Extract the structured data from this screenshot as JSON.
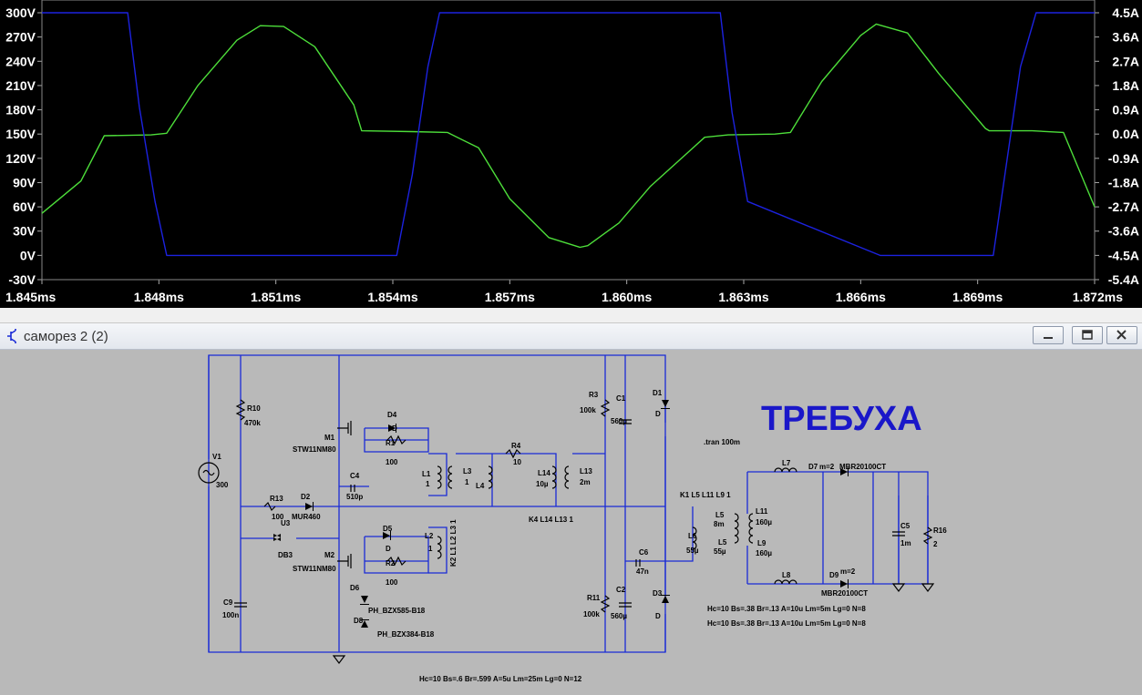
{
  "colors": {
    "plot_background": "#000000",
    "axis_text": "#ffffff",
    "trace_voltage": "#4dde3a",
    "trace_current": "#1c22e0",
    "schematic_background": "#b9b9b9",
    "wire": "#1a2bd6",
    "title_text": "#1a17c9"
  },
  "chart_data": {
    "type": "line",
    "xlabel": "",
    "x_ticks": [
      "1.845ms",
      "1.848ms",
      "1.851ms",
      "1.854ms",
      "1.857ms",
      "1.860ms",
      "1.863ms",
      "1.866ms",
      "1.869ms",
      "1.872ms"
    ],
    "xlim": [
      1.845,
      1.872
    ],
    "left_ticks": [
      "300V",
      "270V",
      "240V",
      "210V",
      "180V",
      "150V",
      "120V",
      "90V",
      "60V",
      "30V",
      "0V",
      "-30V"
    ],
    "ylim_left": [
      -30,
      300
    ],
    "right_ticks": [
      "4.5A",
      "3.6A",
      "2.7A",
      "1.8A",
      "0.9A",
      "0.0A",
      "-0.9A",
      "-1.8A",
      "-2.7A",
      "-3.6A",
      "-4.5A",
      "-5.4A"
    ],
    "ylim_right": [
      -5.4,
      4.5
    ],
    "grid": false,
    "series": [
      {
        "axis": "left",
        "color": "green",
        "x": [
          1.845,
          1.846,
          1.8466,
          1.8478,
          1.8482,
          1.849,
          1.85,
          1.8506,
          1.8512,
          1.852,
          1.853,
          1.8532,
          1.8545,
          1.8554,
          1.8562,
          1.857,
          1.858,
          1.8588,
          1.859,
          1.8598,
          1.8606,
          1.862,
          1.8626,
          1.8638,
          1.8642,
          1.865,
          1.866,
          1.8664,
          1.8672,
          1.868,
          1.8692,
          1.8693,
          1.8704,
          1.8712,
          1.872
        ],
        "y": [
          52,
          92,
          148,
          149,
          151,
          210,
          266,
          284,
          283,
          258,
          186,
          154,
          153,
          152,
          133,
          70,
          22,
          10,
          12,
          40,
          85,
          146,
          149,
          150,
          152,
          215,
          272,
          286,
          275,
          225,
          157,
          154,
          154,
          152,
          60
        ]
      },
      {
        "axis": "right",
        "color": "blue",
        "x": [
          1.845,
          1.8472,
          1.8475,
          1.8479,
          1.8482,
          1.8511,
          1.8541,
          1.8545,
          1.8549,
          1.8552,
          1.8581,
          1.8611,
          1.8624,
          1.8627,
          1.8631,
          1.8665,
          1.8694,
          1.8697,
          1.8701,
          1.8705,
          1.872
        ],
        "y": [
          4.5,
          4.5,
          1.0,
          -2.5,
          -4.5,
          -4.5,
          -4.5,
          -1.5,
          2.5,
          4.5,
          4.5,
          4.5,
          4.5,
          0.8,
          -2.5,
          -4.5,
          -4.5,
          -1.5,
          2.5,
          4.5,
          4.5
        ]
      }
    ]
  },
  "window": {
    "title": "саморез 2 (2)",
    "app_icon": "ltspice-schematic-icon",
    "buttons": {
      "minimize": "minimize-icon",
      "restore": "restore-icon",
      "close": "close-icon"
    }
  },
  "schematic": {
    "heading": "ТРЕБУХА",
    "directive_tran": ".tran 100m",
    "coupling_top": "K1 L5 L11 L9 1",
    "coupling_mid": "K4 L14 L13 1",
    "coupling_vert": "K2 L1 L2 L3 1",
    "model_1": "Hc=10 Bs=.38 Br=.13 A=10u Lm=5m Lg=0 N=8",
    "model_2": "Hc=10 Bs=.38 Br=.13 A=10u Lm=5m Lg=0 N=8",
    "model_3": "Hc=10 Bs=.6 Br=.599 A=5u Lm=25m Lg=0 N=12",
    "components": {
      "R10": "R10",
      "R10_val": "470k",
      "V1": "V1",
      "V1_val": "300",
      "M1": "M1",
      "M1_val": "STW11NM80",
      "D4": "D4",
      "D4_val": "D",
      "R1": "R1",
      "R1_val": "100",
      "C4": "C4",
      "C4_val": "510p",
      "R13": "R13",
      "R13_val": "100",
      "D2": "D2",
      "D2_val": "MUR460",
      "U3": "U3",
      "U3_val": "DB3",
      "D5": "D5",
      "D5_val": "D",
      "M2": "M2",
      "M2_val": "STW11NM80",
      "R2": "R2",
      "R2_val": "100",
      "D6": "D6",
      "D6_val": "PH_BZX585-B18",
      "D8": "D8",
      "D8_val": "PH_BZX384-B18",
      "C9": "C9",
      "C9_val": "100n",
      "L1": "L1",
      "L1_val": "1",
      "L3": "L3",
      "L3_val": "1",
      "L4": "L4",
      "L2": "L2",
      "L2_val": "1",
      "R4": "R4",
      "R4_val": "10",
      "L14": "L14",
      "L14_val": "10µ",
      "L13": "L13",
      "L13_val": "2m",
      "R3": "R3",
      "R3_val": "100k",
      "C1": "C1",
      "C1_val": "560µ",
      "D1": "D1",
      "D1_val": "D",
      "L6": "L6",
      "L6_val": "55µ",
      "C6": "C6",
      "C6_val": "47n",
      "R11": "R11",
      "R11_val": "100k",
      "C2": "C2",
      "C2_val": "560µ",
      "D3": "D3",
      "D3_val": "D",
      "L5": "L5",
      "L5_val": "8m",
      "L5b": "L5",
      "L5b_val": "55µ",
      "L11": "L11",
      "L11_val": "160µ",
      "L9": "L9",
      "L9_val": "160µ",
      "L7": "L7",
      "L8": "L8",
      "D7": "D7",
      "D7_val": "m=2",
      "D7_model": "MBR20100CT",
      "D9": "D9",
      "D9_val": "m=2",
      "D9_model": "MBR20100CT",
      "C5": "C5",
      "C5_val": "1m",
      "R16": "R16",
      "R16_val": "2"
    }
  }
}
